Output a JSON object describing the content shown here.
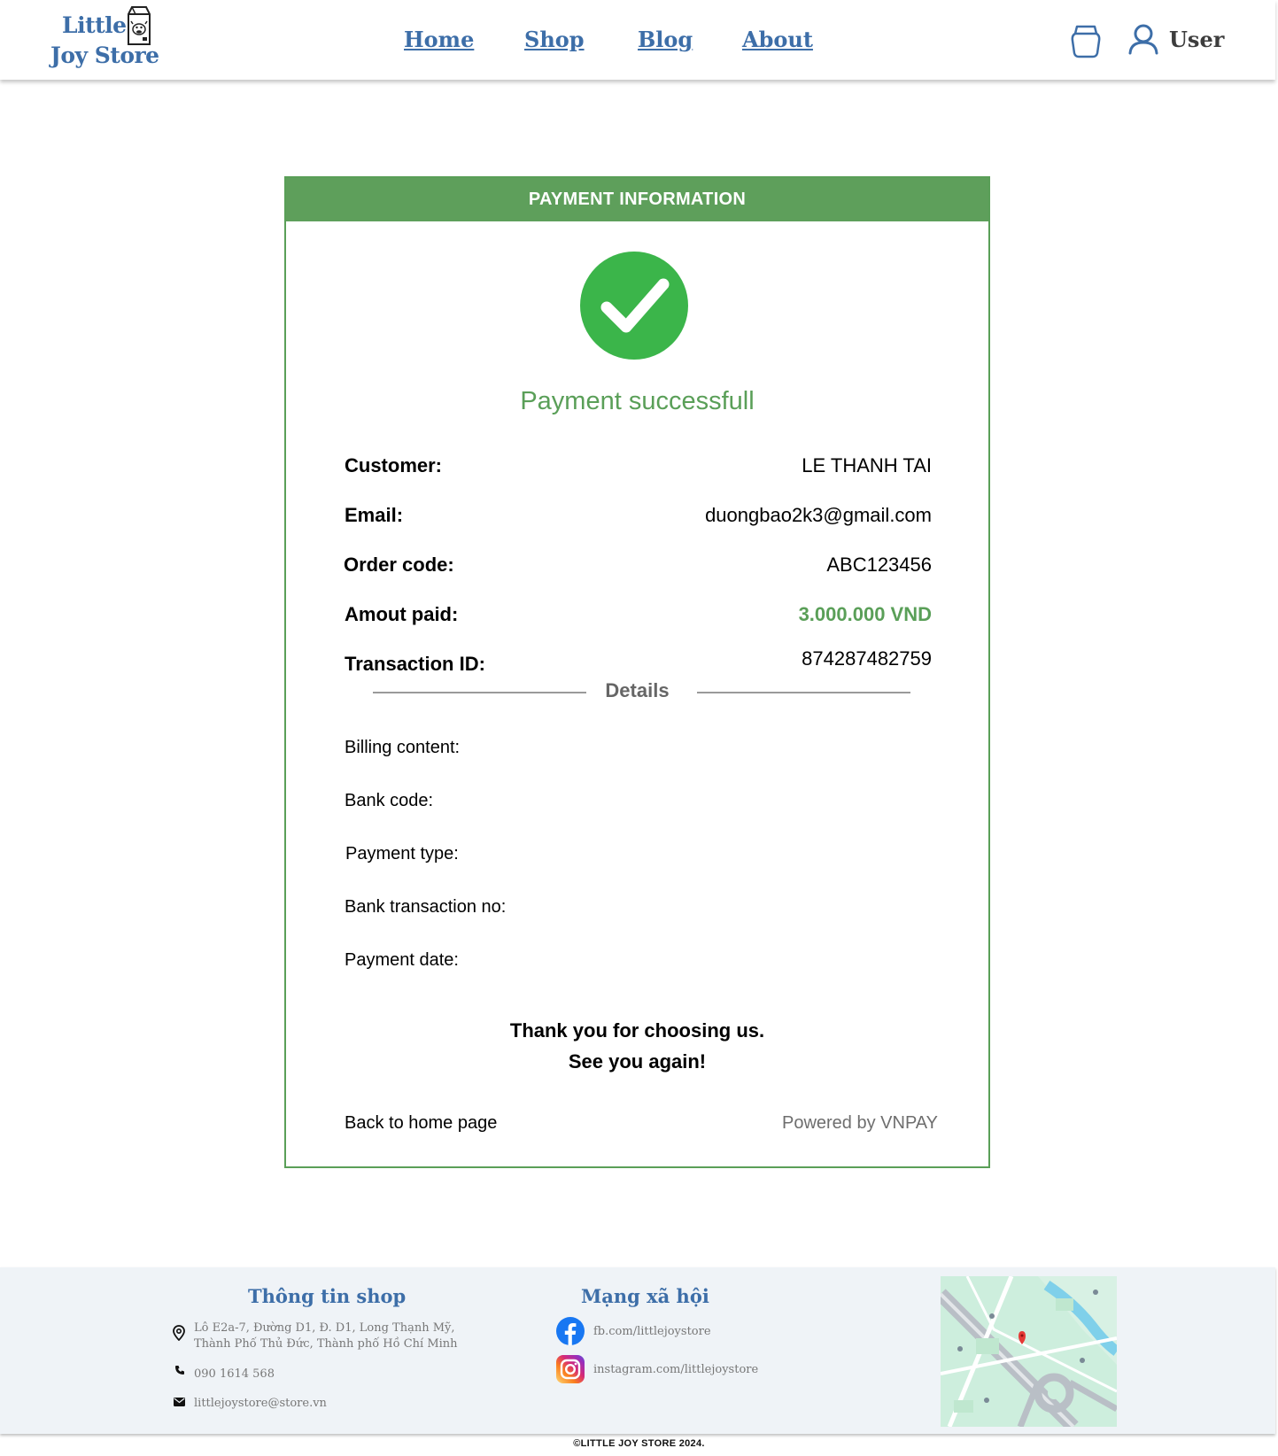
{
  "header": {
    "logo": {
      "line1": "Little",
      "line2": "Joy Store"
    },
    "nav": [
      {
        "label": "Home"
      },
      {
        "label": "Shop"
      },
      {
        "label": "Blog"
      },
      {
        "label": "About"
      }
    ],
    "user_label": "User",
    "icons": {
      "cart": "shopping-bag-icon",
      "user": "user-icon"
    }
  },
  "payment": {
    "header_title": "PAYMENT INFORMATION",
    "status_text": "Payment successfull",
    "status_icon": "check-circle-icon",
    "fields": {
      "customer_label": "Customer:",
      "customer_value": "LE THANH TAI",
      "email_label": "Email:",
      "email_value": "duongbao2k3@gmail.com",
      "order_label": "Order code:",
      "order_value": "ABC123456",
      "amount_label": "Amout paid:",
      "amount_value": "3.000.000 VND",
      "transaction_label": "Transaction ID:",
      "transaction_value": "874287482759"
    },
    "details_title": "Details",
    "details": {
      "billing_label": "Billing content:",
      "bank_code_label": "Bank code:",
      "payment_type_label": "Payment type:",
      "bank_txn_label": "Bank transaction no:",
      "payment_date_label": "Payment date:"
    },
    "thanks_line1": "Thank you for choosing us.",
    "thanks_line2": "See you again!",
    "back_link": "Back to home page",
    "powered_by": "Powered by VNPAY"
  },
  "footer": {
    "shop_info_title": "Thông tin shop",
    "address_line1": "Lô E2a-7, Đường D1, Đ. D1, Long Thạnh Mỹ,",
    "address_line2": "Thành Phố Thủ Đức, Thành phố Hồ Chí Minh",
    "phone": "090 1614 568",
    "email": "littlejoystore@store.vn",
    "social_title": "Mạng xã hội",
    "facebook": "fb.com/littlejoystore",
    "instagram": "instagram.com/littlejoystore",
    "copyright": "©LITTLE JOY STORE 2024."
  },
  "colors": {
    "brand_blue": "#3d6ea8",
    "success_green": "#5a9f58",
    "check_green": "#3bb54a",
    "footer_bg": "#eff3f7"
  }
}
